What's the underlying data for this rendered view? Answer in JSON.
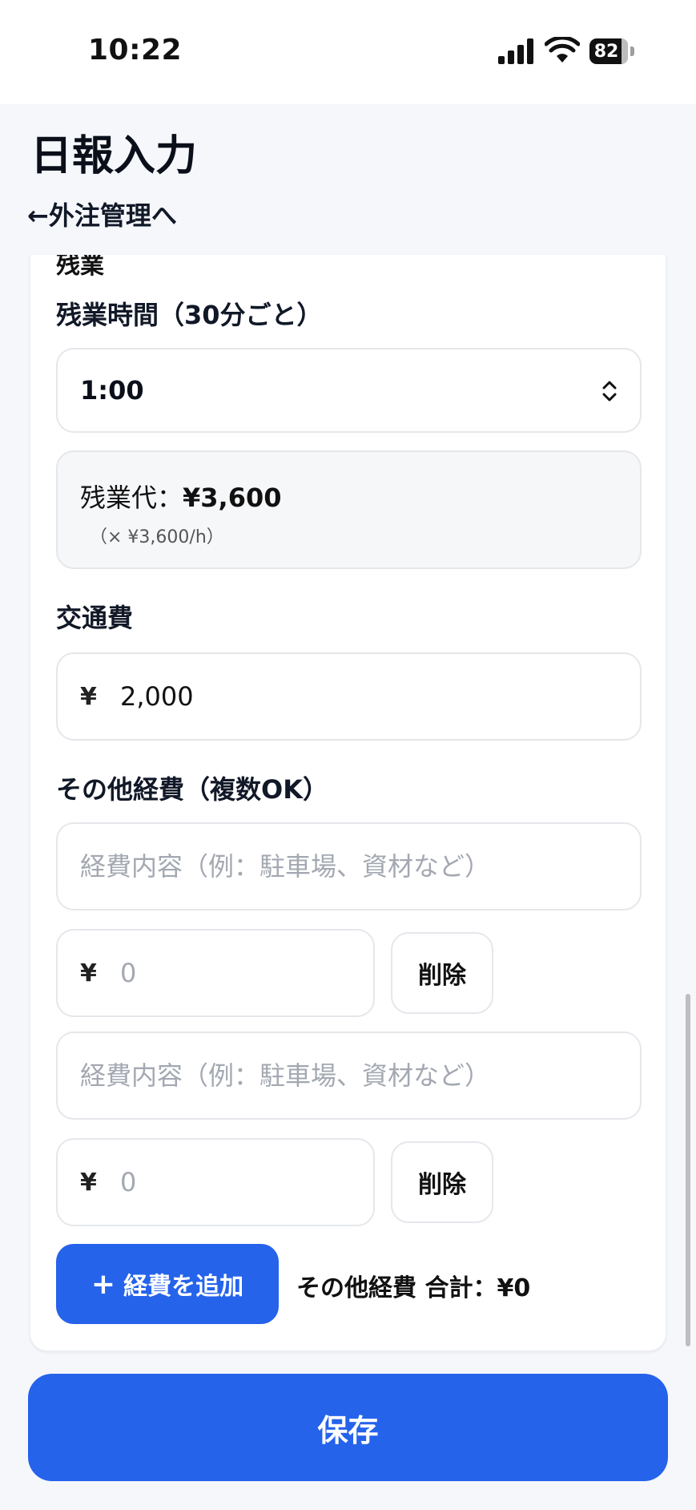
{
  "status_bar": {
    "time": "10:22",
    "battery": "82"
  },
  "header": {
    "title": "日報入力",
    "back_link": "←外注管理へ"
  },
  "overtime": {
    "section_partial": "残業",
    "hours_label": "残業時間（30分ごと）",
    "hours_value": "1:00",
    "pay_label": "残業代：",
    "pay_amount": "¥3,600",
    "rate_note": "（× ¥3,600/h）"
  },
  "transport": {
    "label": "交通費",
    "currency": "¥",
    "value": "2,000"
  },
  "other_expenses": {
    "label": "その他経費（複数OK）",
    "items": [
      {
        "description_placeholder": "経費内容（例：駐車場、資材など）",
        "currency": "¥",
        "amount_placeholder": "0",
        "delete_label": "削除"
      },
      {
        "description_placeholder": "経費内容（例：駐車場、資材など）",
        "currency": "¥",
        "amount_placeholder": "0",
        "delete_label": "削除"
      }
    ],
    "add_icon": "+",
    "add_label": "経費を追加",
    "total_label": "その他経費 合計：¥0"
  },
  "actions": {
    "save_label": "保存"
  },
  "colors": {
    "accent": "#2563eb",
    "border": "#e5e7eb",
    "background": "#f5f7fb"
  },
  "icons": {
    "signal": "cellular-signal-icon",
    "wifi": "wifi-icon",
    "chevron": "chevron-up-down-icon"
  }
}
